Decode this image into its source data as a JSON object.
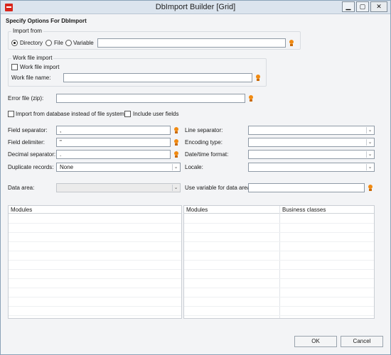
{
  "window": {
    "title": "DbImport Builder [Grid]",
    "close_glyph": "✕",
    "min_glyph": "▁",
    "max_glyph": "▢"
  },
  "header": "Specify Options For DbImport",
  "import_from": {
    "legend": "Import from",
    "options": [
      "Directory",
      "File",
      "Variable"
    ],
    "selected": "Directory",
    "value": ""
  },
  "work_file": {
    "legend": "Work file import",
    "checkbox_label": "Work file import",
    "name_label": "Work file name:",
    "name_value": ""
  },
  "error_file": {
    "label": "Error file (zip):",
    "value": ""
  },
  "options": {
    "import_from_db": "Import from database instead of file system",
    "include_user_fields": "Include user fields"
  },
  "left_fields": {
    "field_separator": {
      "label": "Field separator:",
      "value": ","
    },
    "field_delimiter": {
      "label": "Field delimiter:",
      "value": "\""
    },
    "decimal_separator": {
      "label": "Decimal separator:",
      "value": "."
    },
    "duplicate_records": {
      "label": "Duplicate records:",
      "value": "None"
    }
  },
  "right_fields": {
    "line_separator": {
      "label": "Line separator:",
      "value": ""
    },
    "encoding_type": {
      "label": "Encoding type:",
      "value": ""
    },
    "datetime_format": {
      "label": "Date/time format:",
      "value": ""
    },
    "locale": {
      "label": "Locale:",
      "value": ""
    }
  },
  "data_area": {
    "label": "Data area:",
    "value": ""
  },
  "use_variable": {
    "label": "Use variable for data area:",
    "value": ""
  },
  "left_table": {
    "columns": [
      "Modules"
    ]
  },
  "right_table": {
    "columns": [
      "Modules",
      "Business classes"
    ]
  },
  "buttons": {
    "ok": "OK",
    "cancel": "Cancel"
  },
  "colors": {
    "accent_bulb": "#f08a12",
    "app_icon": "#d9261c"
  },
  "icons": {
    "field_hint": "lightbulb-icon",
    "dropdown": "chevron-down-icon"
  }
}
